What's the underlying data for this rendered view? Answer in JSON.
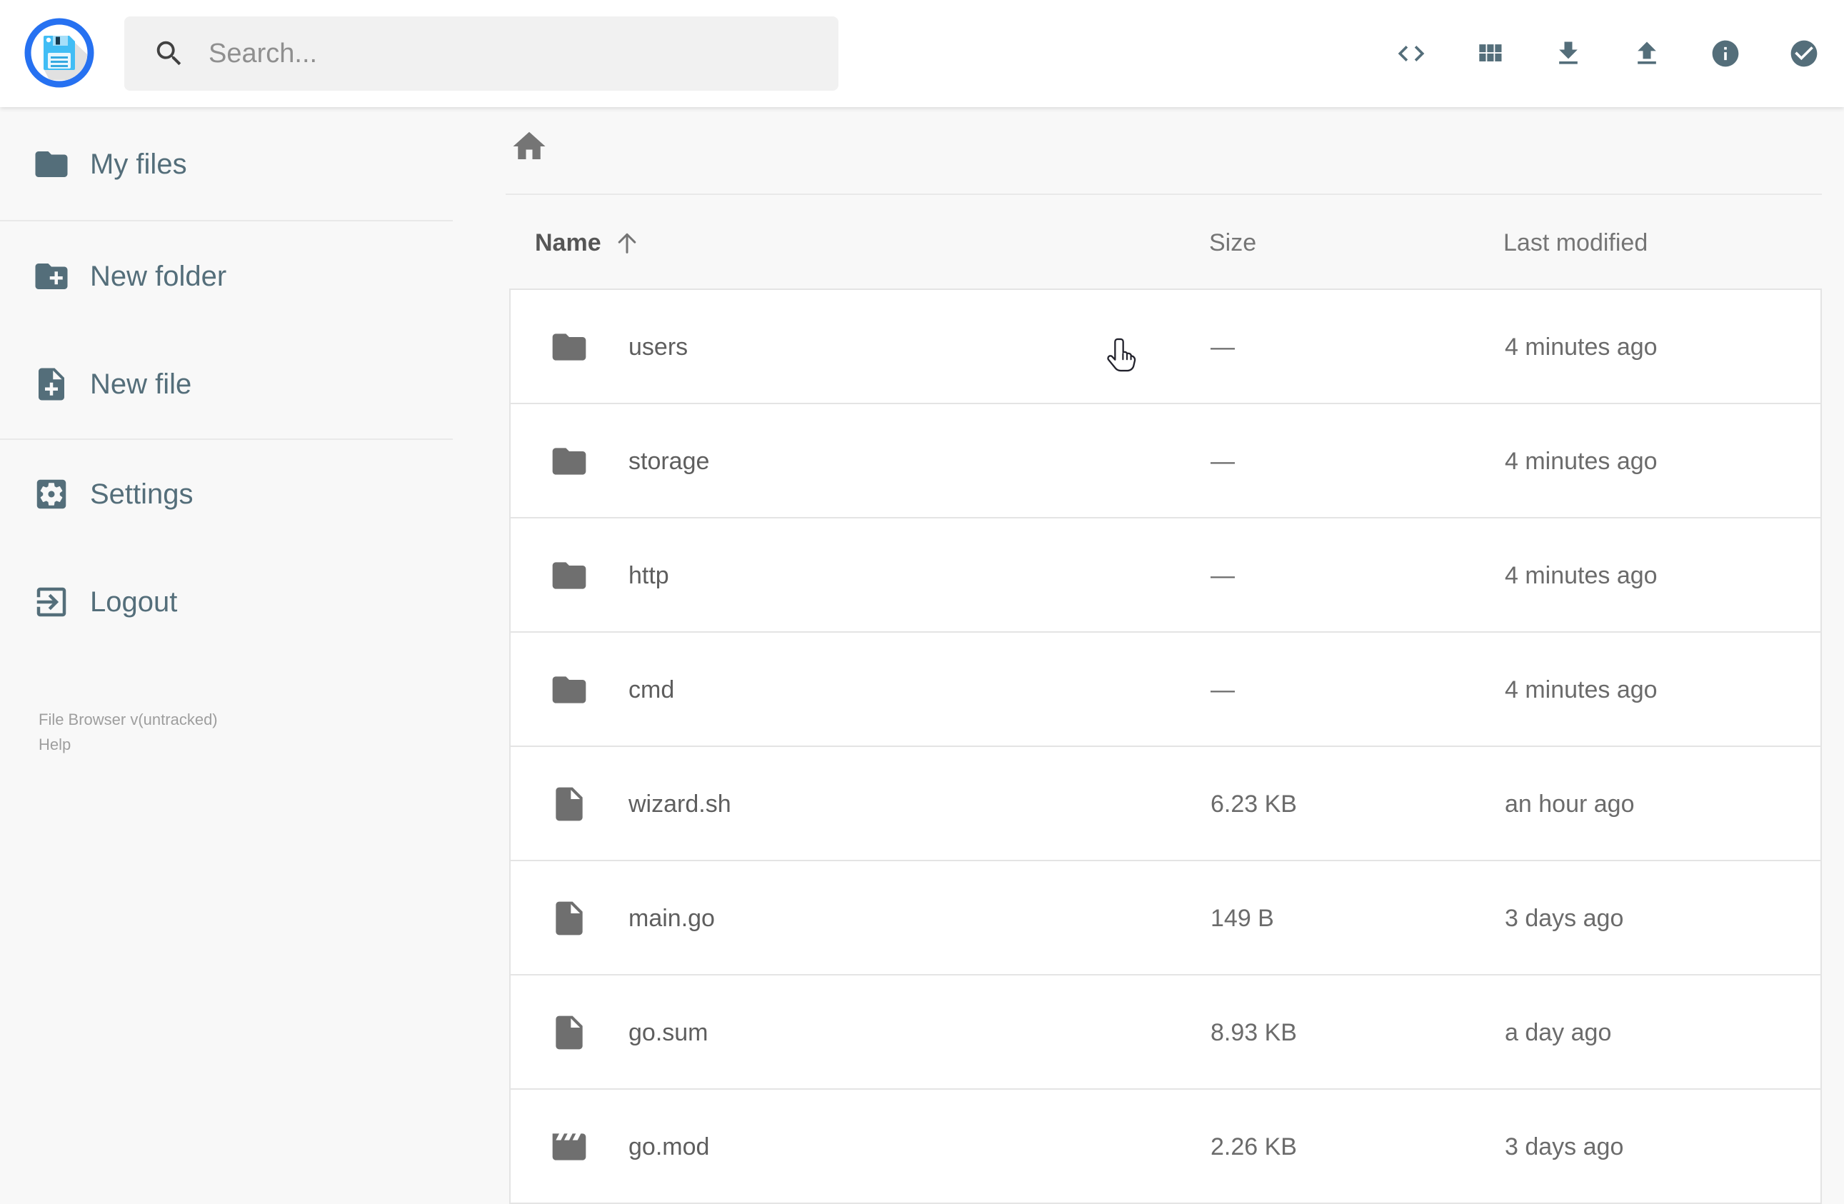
{
  "header": {
    "search": {
      "placeholder": "Search..."
    },
    "action_icons": [
      "code",
      "grid-view",
      "download",
      "upload",
      "info",
      "select-multiple"
    ]
  },
  "sidebar": {
    "items": [
      {
        "label": "My files",
        "icon": "folder-icon"
      },
      {
        "label": "New folder",
        "icon": "new-folder-icon"
      },
      {
        "label": "New file",
        "icon": "new-file-icon"
      },
      {
        "label": "Settings",
        "icon": "settings-icon"
      },
      {
        "label": "Logout",
        "icon": "logout-icon"
      }
    ],
    "credits": {
      "version": "File Browser v(untracked)",
      "help": "Help"
    }
  },
  "breadcrumb": {
    "home_icon": "home-icon"
  },
  "listing": {
    "columns": {
      "name": "Name",
      "size": "Size",
      "modified": "Last modified"
    },
    "sort": {
      "column": "Name",
      "direction": "ascending"
    },
    "rows": [
      {
        "name": "users",
        "type": "folder",
        "size": "—",
        "modified": "4 minutes ago"
      },
      {
        "name": "storage",
        "type": "folder",
        "size": "—",
        "modified": "4 minutes ago"
      },
      {
        "name": "http",
        "type": "folder",
        "size": "—",
        "modified": "4 minutes ago"
      },
      {
        "name": "cmd",
        "type": "folder",
        "size": "—",
        "modified": "4 minutes ago"
      },
      {
        "name": "wizard.sh",
        "type": "file",
        "size": "6.23 KB",
        "modified": "an hour ago"
      },
      {
        "name": "main.go",
        "type": "file",
        "size": "149 B",
        "modified": "3 days ago"
      },
      {
        "name": "go.sum",
        "type": "file",
        "size": "8.93 KB",
        "modified": "a day ago"
      },
      {
        "name": "go.mod",
        "type": "movie",
        "size": "2.26 KB",
        "modified": "3 days ago"
      }
    ]
  },
  "colors": {
    "logo_ring_blue": "#2671f1",
    "logo_floppy_blue": "#41bdf5",
    "header_icon_slate": "#546e7a",
    "row_icon_gray": "#6f6f6f",
    "border_gray": "#e4e4e4",
    "page_background": "#f8f8f8"
  },
  "cursor": {
    "shape": "hand-pointer",
    "over_row": "users"
  }
}
